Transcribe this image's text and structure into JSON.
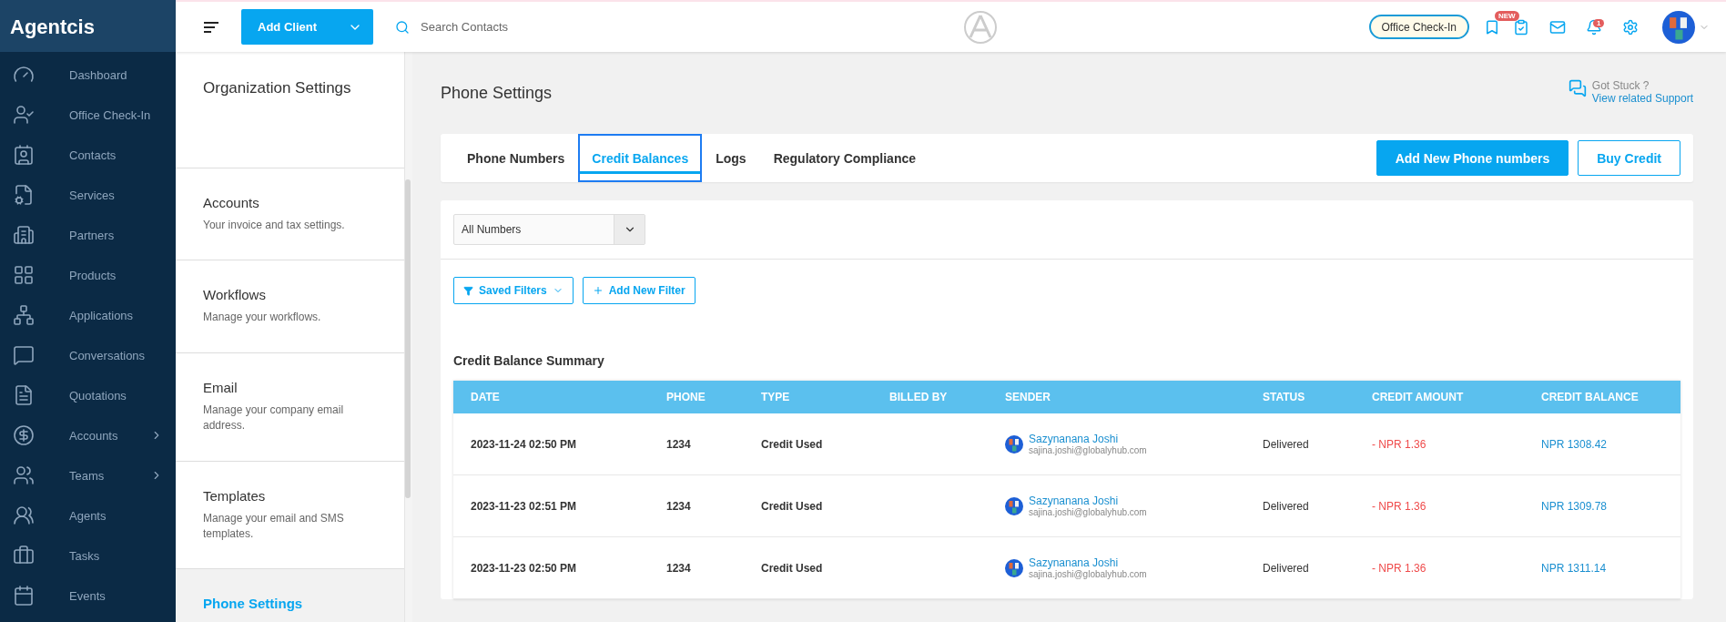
{
  "brand": "Agentcis",
  "nav": [
    {
      "label": "Dashboard",
      "expandable": false
    },
    {
      "label": "Office Check-In",
      "expandable": false
    },
    {
      "label": "Contacts",
      "expandable": false
    },
    {
      "label": "Services",
      "expandable": false
    },
    {
      "label": "Partners",
      "expandable": false
    },
    {
      "label": "Products",
      "expandable": false
    },
    {
      "label": "Applications",
      "expandable": false
    },
    {
      "label": "Conversations",
      "expandable": false
    },
    {
      "label": "Quotations",
      "expandable": false
    },
    {
      "label": "Accounts",
      "expandable": true
    },
    {
      "label": "Teams",
      "expandable": true
    },
    {
      "label": "Agents",
      "expandable": false
    },
    {
      "label": "Tasks",
      "expandable": false
    },
    {
      "label": "Events",
      "expandable": false
    }
  ],
  "header": {
    "add_client": "Add Client",
    "search": {
      "placeholder": "Search Contacts"
    },
    "check_in": "Office Check-In",
    "new_badge": "NEW",
    "notification_count": "1"
  },
  "settings_panel": {
    "title": "Organization Settings",
    "items": [
      {
        "title": "Accounts",
        "description": "Your invoice and tax settings.",
        "selected": false
      },
      {
        "title": "Workflows",
        "description": "Manage your workflows.",
        "selected": false
      },
      {
        "title": "Email",
        "description": "Manage your company email address.",
        "selected": false
      },
      {
        "title": "Templates",
        "description": "Manage your email and SMS templates.",
        "selected": false
      },
      {
        "title": "Phone Settings",
        "selected": true
      }
    ]
  },
  "page": {
    "title": "Phone Settings",
    "help": {
      "question": "Got Stuck ?",
      "link": "View related Support"
    },
    "tabs": [
      {
        "label": "Phone Numbers",
        "selected": false
      },
      {
        "label": "Credit Balances",
        "selected": true
      },
      {
        "label": "Logs",
        "selected": false
      },
      {
        "label": "Regulatory Compliance",
        "selected": false
      }
    ],
    "actions": [
      {
        "label": "Add New Phone numbers",
        "kind": "primary"
      },
      {
        "label": "Buy Credit",
        "kind": "outline"
      }
    ],
    "number_select": {
      "value": "All Numbers"
    },
    "filters": [
      {
        "label": "Saved Filters",
        "kind": "dropdown"
      },
      {
        "label": "Add New Filter",
        "kind": "add"
      }
    ],
    "summary_title": "Credit Balance Summary",
    "table": {
      "columns": [
        "DATE",
        "PHONE",
        "TYPE",
        "BILLED BY",
        "SENDER",
        "STATUS",
        "CREDIT AMOUNT",
        "CREDIT BALANCE"
      ],
      "rows": [
        {
          "date": "2023-11-24 02:50 PM",
          "phone": "1234",
          "type": "Credit Used",
          "sender": {
            "name": "Sazynanana Joshi",
            "email": "sajina.joshi@globalyhub.com"
          },
          "status": "Delivered",
          "credit_amount": "- NPR 1.36",
          "credit_balance": "NPR 1308.42"
        },
        {
          "date": "2023-11-23 02:51 PM",
          "phone": "1234",
          "type": "Credit Used",
          "sender": {
            "name": "Sazynanana Joshi",
            "email": "sajina.joshi@globalyhub.com"
          },
          "status": "Delivered",
          "credit_amount": "- NPR 1.36",
          "credit_balance": "NPR 1309.78"
        },
        {
          "date": "2023-11-23 02:50 PM",
          "phone": "1234",
          "type": "Credit Used",
          "sender": {
            "name": "Sazynanana Joshi",
            "email": "sajina.joshi@globalyhub.com"
          },
          "status": "Delivered",
          "credit_amount": "- NPR 1.36",
          "credit_balance": "NPR 1311.14"
        }
      ]
    }
  }
}
